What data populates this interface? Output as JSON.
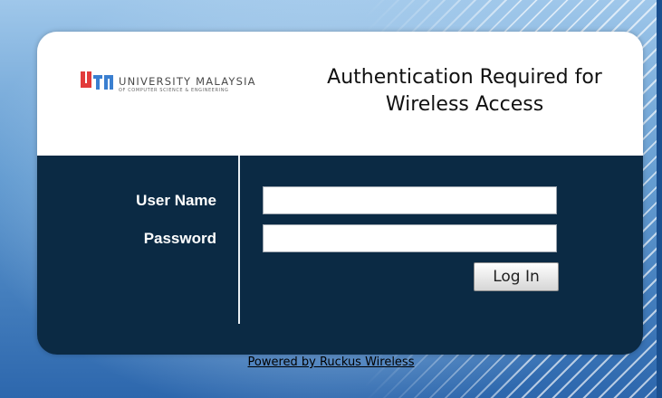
{
  "header": {
    "logo_text": "UNIVERSITY MALAYSIA",
    "logo_subtext": "OF COMPUTER SCIENCE & ENGINEERING",
    "title_line1": "Authentication Required for",
    "title_line2": "Wireless Access"
  },
  "form": {
    "username_label": "User Name",
    "password_label": "Password",
    "username_value": "",
    "password_value": "",
    "login_button": "Log In"
  },
  "footer": {
    "link_text": "Powered by Ruckus Wireless"
  },
  "colors": {
    "panel": "#0b2a44",
    "logo_red": "#e23b3b",
    "logo_blue": "#3a7fd0"
  }
}
